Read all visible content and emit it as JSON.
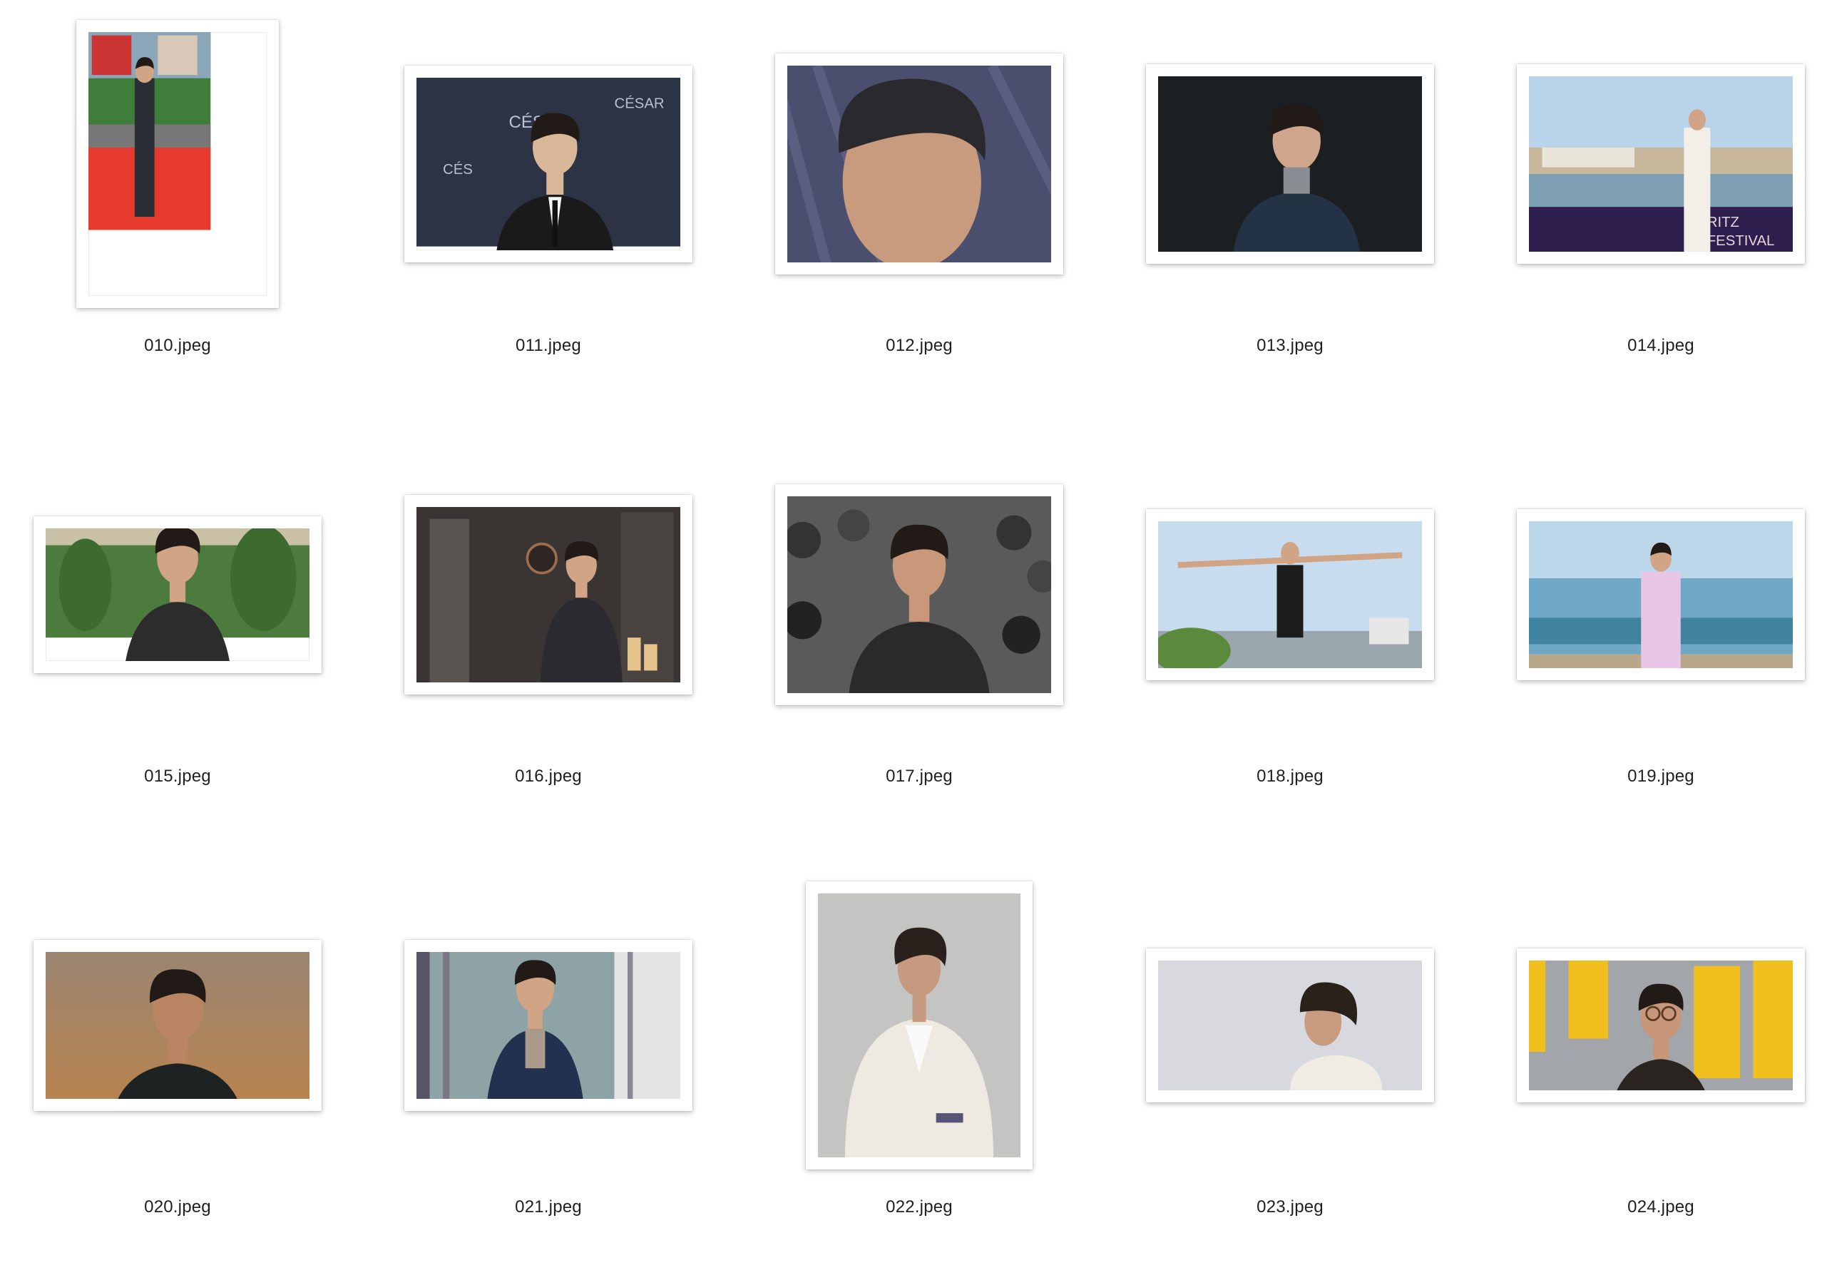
{
  "window": {
    "view": "icon-view"
  },
  "files": [
    {
      "name": "010.jpeg",
      "orientation": "portrait",
      "scene": "red-carpet-full-body",
      "colors": [
        "#e53a2c",
        "#2b2e35",
        "#3f7d3a"
      ]
    },
    {
      "name": "011.jpeg",
      "orientation": "landscape",
      "scene": "press-wall-portrait",
      "colors": [
        "#2b3345",
        "#1a1a1a",
        "#d9b89a"
      ]
    },
    {
      "name": "012.jpeg",
      "orientation": "landscape",
      "scene": "close-up-face",
      "colors": [
        "#4a4f6e",
        "#2a2a2e",
        "#c89a7e"
      ]
    },
    {
      "name": "013.jpeg",
      "orientation": "landscape",
      "scene": "dark-studio-portrait",
      "colors": [
        "#1c1f22",
        "#243246",
        "#cfa58b"
      ]
    },
    {
      "name": "014.jpeg",
      "orientation": "landscape",
      "scene": "festival-terrace",
      "colors": [
        "#b9d4ea",
        "#2d1e4d",
        "#f2efe8"
      ]
    },
    {
      "name": "015.jpeg",
      "orientation": "landscape",
      "scene": "garden-portrait",
      "colors": [
        "#4d7a3d",
        "#c9c1a6",
        "#2c2c2c"
      ]
    },
    {
      "name": "016.jpeg",
      "orientation": "landscape",
      "scene": "dim-interior",
      "colors": [
        "#3a3432",
        "#2a2a30",
        "#e7c48e"
      ]
    },
    {
      "name": "017.jpeg",
      "orientation": "landscape",
      "scene": "photographers-crowd",
      "colors": [
        "#2a2a2a",
        "#5a5a5a",
        "#c9977a"
      ]
    },
    {
      "name": "018.jpeg",
      "orientation": "landscape",
      "scene": "arms-wide-harbor",
      "colors": [
        "#c7dcef",
        "#1c1c1c",
        "#5b8a3c"
      ]
    },
    {
      "name": "019.jpeg",
      "orientation": "landscape",
      "scene": "seaside-portrait",
      "colors": [
        "#6fa7c6",
        "#1f6a86",
        "#e8c7e6"
      ]
    },
    {
      "name": "020.jpeg",
      "orientation": "landscape",
      "scene": "sunset-period-costume",
      "colors": [
        "#cfa67a",
        "#1d2222",
        "#b8834f"
      ]
    },
    {
      "name": "021.jpeg",
      "orientation": "landscape",
      "scene": "station-glasses-coat",
      "colors": [
        "#8ea3a6",
        "#23304f",
        "#e4e4e4"
      ]
    },
    {
      "name": "022.jpeg",
      "orientation": "portrait",
      "scene": "cream-suit-studio",
      "colors": [
        "#c4c4c2",
        "#efeae1",
        "#2b211c"
      ]
    },
    {
      "name": "023.jpeg",
      "orientation": "landscape",
      "scene": "profile-grey-sky",
      "colors": [
        "#d8d9df",
        "#2b211b",
        "#c89a7e"
      ]
    },
    {
      "name": "024.jpeg",
      "orientation": "landscape",
      "scene": "yellow-letters-glasses",
      "colors": [
        "#a2a6ab",
        "#f2c01e",
        "#2a2420"
      ]
    }
  ]
}
